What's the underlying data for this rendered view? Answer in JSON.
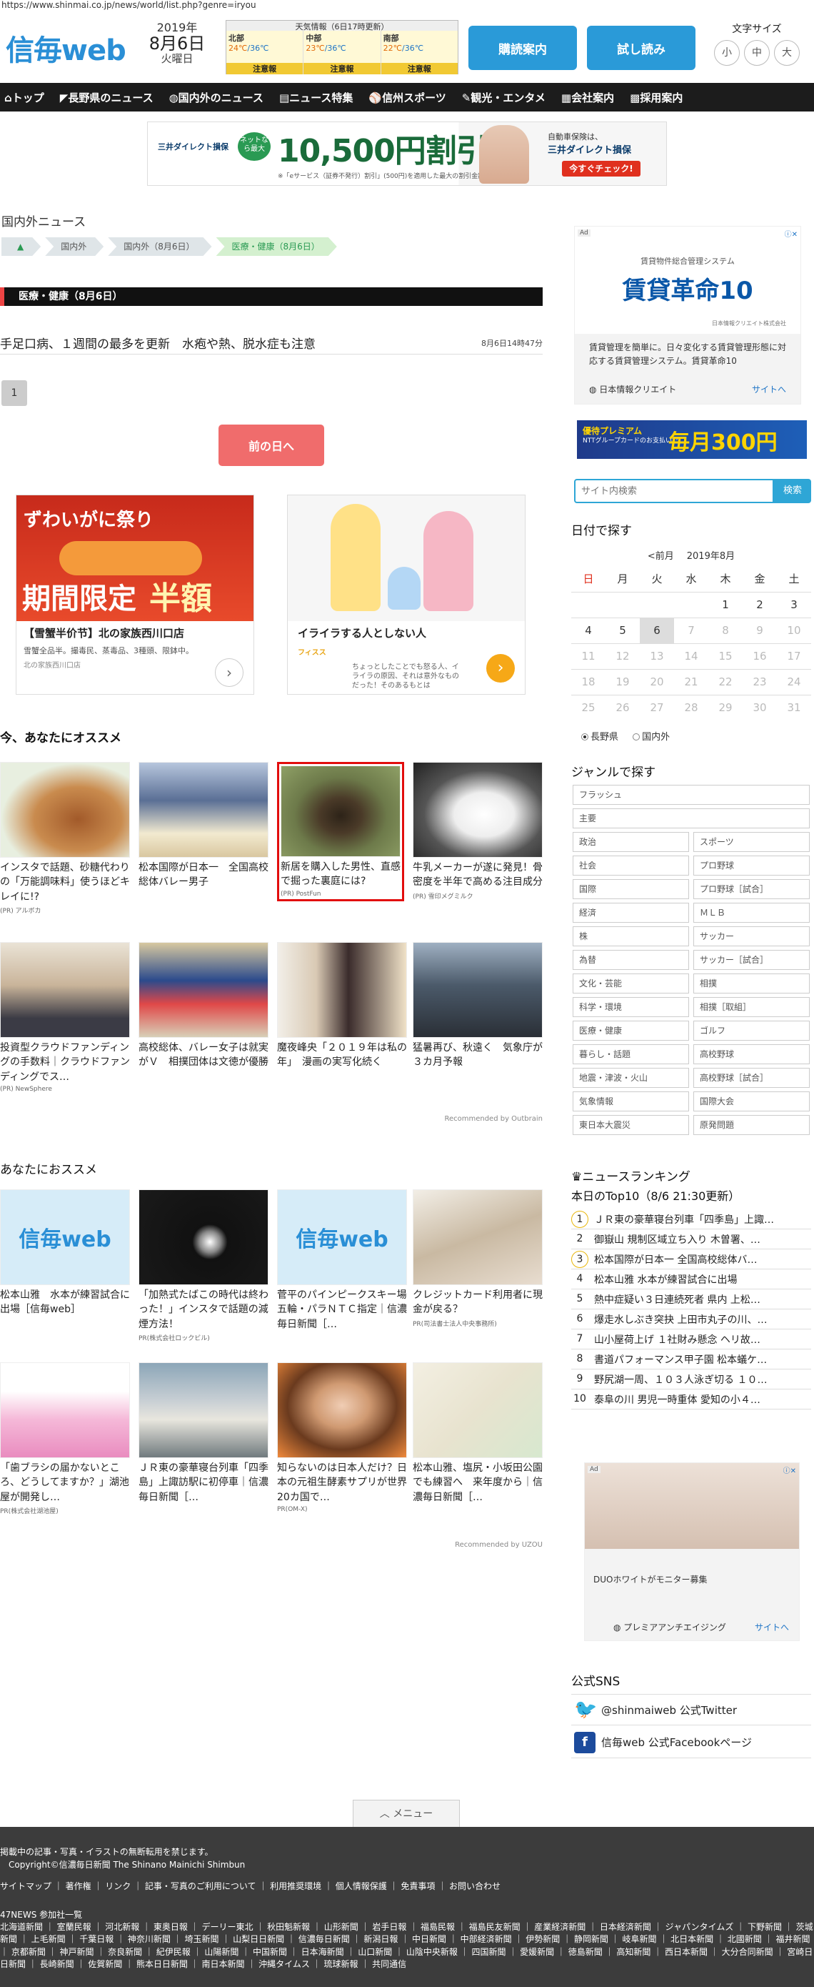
{
  "url": "https://www.shinmai.co.jp/news/world/list.php?genre=iryou",
  "header": {
    "logo": "信毎web",
    "year": "2019年",
    "monthday": "8月6日",
    "weekday": "火曜日",
    "weather_title": "天気情報（6日17時更新）",
    "weather": [
      {
        "region": "北部",
        "hi": "24℃",
        "lo": "/36℃",
        "alert": "注意報"
      },
      {
        "region": "中部",
        "hi": "23℃",
        "lo": "/36℃",
        "alert": "注意報"
      },
      {
        "region": "南部",
        "hi": "22℃",
        "lo": "/36℃",
        "alert": "注意報"
      }
    ],
    "btn_subscribe": "購読案内",
    "btn_trial": "試し読み",
    "font_size_label": "文字サイズ",
    "font_sizes": [
      "小",
      "中",
      "大"
    ]
  },
  "nav": [
    "トップ",
    "長野県のニュース",
    "国内外のニュース",
    "ニュース特集",
    "信州スポーツ",
    "観光・エンタメ",
    "会社案内",
    "採用案内"
  ],
  "nav_icons": [
    "home-icon",
    "map-icon",
    "globe-icon",
    "document-icon",
    "sports-icon",
    "camera-icon",
    "building-icon",
    "briefcase-icon"
  ],
  "banner": {
    "brand": "三井ダイレクト損保",
    "oval": "ネットなら最大",
    "headline": "10,500円割引",
    "note": "※「eサービス（証券不発行）割引」(500円)を適用した最大の割引金額です。",
    "r1": "自動車保険は、",
    "r2": "三井ダイレクト損保",
    "cta": "今すぐチェック!"
  },
  "page_title": "国内外ニュース",
  "breadcrumb": [
    "国内外",
    "国内外（8月6日）",
    "医療・健康（8月6日）"
  ],
  "section_heading": "医療・健康（8月6日）",
  "article": {
    "title": "手足口病、１週間の最多を更新　水疱や熱、脱水症も注意",
    "time": "8月6日14時47分"
  },
  "pagination": [
    "1"
  ],
  "prev_day": "前の日へ",
  "ad_left": {
    "t1": "ずわいがに祭り",
    "t2": "期間限定",
    "t3": "半額",
    "title": "【雪蟹半价节】北の家族西川口店",
    "desc": "雪蟹全品半。撮毒民、蒸毒品、3種頭、限鉢中。",
    "source": "北の家族西川口店"
  },
  "ad_right": {
    "title": "イライラする人としない人",
    "source": "フィスス",
    "desc": "ちょっとしたことでも怒る人、イライラの原因、それは意外なものだった！そのあるもとは"
  },
  "recommend_heading": "今、あなたにオススメ",
  "recommend": [
    {
      "title": "インスタで話題、砂糖代わりの「万能調味料」使うほどキレイに!?",
      "sponsor": "(PR) アルボカ"
    },
    {
      "title": "松本国際が日本一　全国高校総体バレー男子",
      "sponsor": ""
    },
    {
      "title": "新居を購入した男性、直感で掘った裏庭には?",
      "sponsor": "(PR) PostFun"
    },
    {
      "title": "牛乳メーカーが遂に発見！骨密度を半年で高める注目成分",
      "sponsor": "(PR) 雪印メグミルク"
    },
    {
      "title": "投資型クラウドファンディングの手数料｜クラウドファンディングでス…",
      "sponsor": "(PR) NewSphere"
    },
    {
      "title": "高校総体、バレー女子は就実がＶ　相撲団体は文徳が優勝",
      "sponsor": ""
    },
    {
      "title": "魔夜峰央「２０１９年は私の年」　漫画の実写化続く",
      "sponsor": ""
    },
    {
      "title": "猛暑再び、秋遠く　気象庁が３カ月予報",
      "sponsor": ""
    }
  ],
  "outbrain": "Recommended by Outbrain",
  "recommend2_heading": "あなたにおススメ",
  "recommend2": [
    {
      "title": "松本山雅　水本が練習試合に出場［信毎web］",
      "sponsor": ""
    },
    {
      "title": "「加熱式たばこの時代は終わった！」インスタで話題の減煙方法！",
      "sponsor": "PR(株式会社ロックビル)"
    },
    {
      "title": "菅平のパインピークスキー場　五輪・パラＮＴＣ指定｜信濃毎日新聞［…",
      "sponsor": ""
    },
    {
      "title": "クレジットカード利用者に現金が戻る？",
      "sponsor": "PR(司法書士法人中央事務所)"
    },
    {
      "title": "「歯ブラシの届かないところ、どうしてますか？」湖池屋が開発し…",
      "sponsor": "PR(株式会社湖池屋)"
    },
    {
      "title": "ＪＲ東の豪華寝台列車「四季島」上諏訪駅に初停車｜信濃毎日新聞［…",
      "sponsor": ""
    },
    {
      "title": "知らないのは日本人だけ？日本の元祖生酵素サプリが世界20カ国で…",
      "sponsor": "PR(OM-X)"
    },
    {
      "title": "松本山雅、塩尻・小坂田公園でも練習へ　来年度から｜信濃毎日新聞［…",
      "sponsor": ""
    }
  ],
  "uzou": "Recommended by UZOU",
  "side_ad": {
    "tag": "Ad",
    "top": "賃貸物件総合管理システム",
    "title": "賃貸革命10",
    "sub": "日本情報クリエイト株式会社",
    "desc": "賃貸管理を簡単に。日々変化する賃貸管理形態に対応する賃貸管理システム。賃貸革命10",
    "company": "日本情報クリエイト",
    "site": "サイトへ"
  },
  "side_banner": {
    "a": "優待プレミアム",
    "b": "NTTグループカードのお支払いで",
    "c": "毎月300円"
  },
  "search": {
    "placeholder": "サイト内検索",
    "button": "検索"
  },
  "calendar": {
    "heading": "日付で探す",
    "prev": "<前月",
    "month": "2019年8月",
    "weekdays": [
      "日",
      "月",
      "火",
      "水",
      "木",
      "金",
      "土"
    ],
    "weeks": [
      [
        "",
        "",
        "",
        "",
        "1",
        "2",
        "3"
      ],
      [
        "4",
        "5",
        "6",
        "7",
        "8",
        "9",
        "10"
      ],
      [
        "11",
        "12",
        "13",
        "14",
        "15",
        "16",
        "17"
      ],
      [
        "18",
        "19",
        "20",
        "21",
        "22",
        "23",
        "24"
      ],
      [
        "25",
        "26",
        "27",
        "28",
        "29",
        "30",
        "31"
      ]
    ],
    "today": "6",
    "radio": [
      "長野県",
      "国内外"
    ]
  },
  "genre": {
    "heading": "ジャンルで探す",
    "items": [
      "フラッシュ",
      "主要",
      "政治",
      "スポーツ",
      "社会",
      "プロ野球",
      "国際",
      "プロ野球［試合］",
      "経済",
      "ＭＬＢ",
      "株",
      "サッカー",
      "為替",
      "サッカー［試合］",
      "文化・芸能",
      "相撲",
      "科学・環境",
      "相撲［取組］",
      "医療・健康",
      "ゴルフ",
      "暮らし・話題",
      "高校野球",
      "地震・津波・火山",
      "高校野球［試合］",
      "気象情報",
      "国際大会",
      "東日本大震災",
      "原発問題"
    ]
  },
  "ranking": {
    "heading": "ニュースランキング",
    "sub": "本日のTop10（8/6 21:30更新）",
    "items": [
      "ＪＲ東の豪華寝台列車「四季島」上諏…",
      "御嶽山 規制区域立ち入り 木曽署、…",
      "松本国際が日本一 全国高校総体バ…",
      "松本山雅 水本が練習試合に出場",
      "熱中症疑い３日連続死者 県内 上松…",
      "爆走水しぶき突抉 上田市丸子の川、…",
      "山小屋荷上げ １社財み懸念 ヘリ故…",
      "書道パフォーマンス甲子園 松本蟻ケ…",
      "野尻湖一周、１０３人泳ぎ切る １０…",
      "泰阜の川 男児一時重体 愛知の小４…"
    ]
  },
  "side_ad2": {
    "tag": "Ad",
    "desc": "DUOホワイトがモニター募集",
    "company": "プレミアアンチエイジング",
    "site": "サイトへ"
  },
  "sns": {
    "heading": "公式SNS",
    "twitter": "@shinmaiweb 公式Twitter",
    "facebook": "信毎web 公式Facebookページ"
  },
  "menu": "メニュー",
  "footer": {
    "l1": "掲載中の記事・写真・イラストの無断転用を禁じます。",
    "l2": "Copyright©信濃毎日新聞 The Shinano Mainichi Shimbun",
    "links": "サイトマップ ｜ 著作権 ｜ リンク ｜ 記事・写真のご利用について ｜ 利用推奨環境 ｜ 個人情報保護 ｜ 免責事項 ｜ お問い合わせ",
    "l4": "47NEWS 参加社一覧",
    "papers": "北海道新聞 ｜ 室蘭民報 ｜ 河北新報 ｜ 東奥日報 ｜ デーリー東北 ｜ 秋田魁新報 ｜ 山形新聞 ｜ 岩手日報 ｜ 福島民報 ｜ 福島民友新聞 ｜ 産業経済新聞 ｜ 日本経済新聞 ｜ ジャパンタイムズ ｜ 下野新聞 ｜ 茨城新聞 ｜ 上毛新聞 ｜ 千葉日報 ｜ 神奈川新聞 ｜ 埼玉新聞 ｜ 山梨日日新聞 ｜ 信濃毎日新聞 ｜ 新潟日報 ｜ 中日新聞 ｜ 中部経済新聞 ｜ 伊勢新聞 ｜ 静岡新聞 ｜ 岐阜新聞 ｜ 北日本新聞 ｜ 北國新聞 ｜ 福井新聞 ｜ 京都新聞 ｜ 神戸新聞 ｜ 奈良新聞 ｜ 紀伊民報 ｜ 山陽新聞 ｜ 中国新聞 ｜ 日本海新聞 ｜ 山口新聞 ｜ 山陰中央新報 ｜ 四国新聞 ｜ 愛媛新聞 ｜ 徳島新聞 ｜ 高知新聞 ｜ 西日本新聞 ｜ 大分合同新聞 ｜ 宮崎日日新聞 ｜ 長崎新聞 ｜ 佐賀新聞 ｜ 熊本日日新聞 ｜ 南日本新聞 ｜ 沖縄タイムス ｜ 琉球新報 ｜ 共同通信"
  }
}
